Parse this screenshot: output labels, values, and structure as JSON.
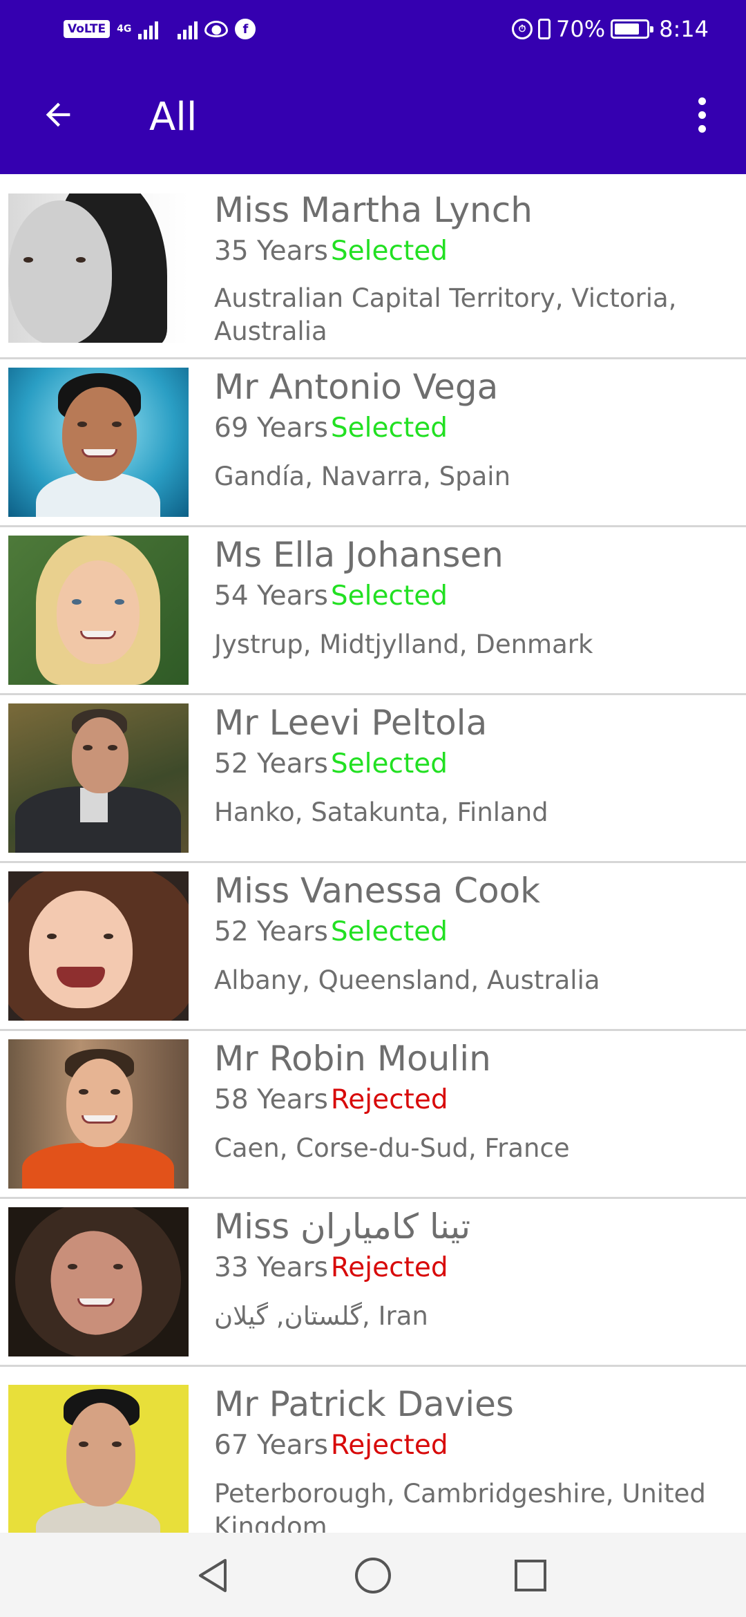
{
  "status_bar": {
    "volte": "VoLTE",
    "network": "4G",
    "battery_text": "70%",
    "battery_level": 0.7,
    "time": "8:14"
  },
  "app_bar": {
    "title": "All",
    "back_icon": "arrow-back-icon",
    "menu_icon": "more-vert-icon"
  },
  "colors": {
    "primary": "#3500b0",
    "selected": "#22e022",
    "rejected": "#d80a0a",
    "text": "#6e6e6e",
    "divider": "#d6d6d6"
  },
  "people": [
    {
      "name": "Miss Martha Lynch",
      "age": "35 Years",
      "status": "Selected",
      "location": "Australian Capital Territory, Victoria, Australia"
    },
    {
      "name": "Mr Antonio Vega",
      "age": "69 Years",
      "status": "Selected",
      "location": "Gandía, Navarra, Spain"
    },
    {
      "name": "Ms Ella Johansen",
      "age": "54 Years",
      "status": "Selected",
      "location": "Jystrup, Midtjylland, Denmark"
    },
    {
      "name": "Mr Leevi Peltola",
      "age": "52 Years",
      "status": "Selected",
      "location": "Hanko, Satakunta, Finland"
    },
    {
      "name": "Miss Vanessa Cook",
      "age": "52 Years",
      "status": "Selected",
      "location": "Albany, Queensland, Australia"
    },
    {
      "name": "Mr Robin Moulin",
      "age": "58 Years",
      "status": "Rejected",
      "location": "Caen, Corse-du-Sud, France"
    },
    {
      "name": "Miss تینا کامیاران",
      "age": "33 Years",
      "status": "Rejected",
      "location": "گلستان, گیلان, Iran"
    },
    {
      "name": "Mr Patrick Davies",
      "age": "67 Years",
      "status": "Rejected",
      "location": "Peterborough, Cambridgeshire, United Kingdom"
    }
  ],
  "nav_bar": {
    "back_icon": "nav-back-icon",
    "home_icon": "nav-home-icon",
    "recents_icon": "nav-recents-icon"
  }
}
